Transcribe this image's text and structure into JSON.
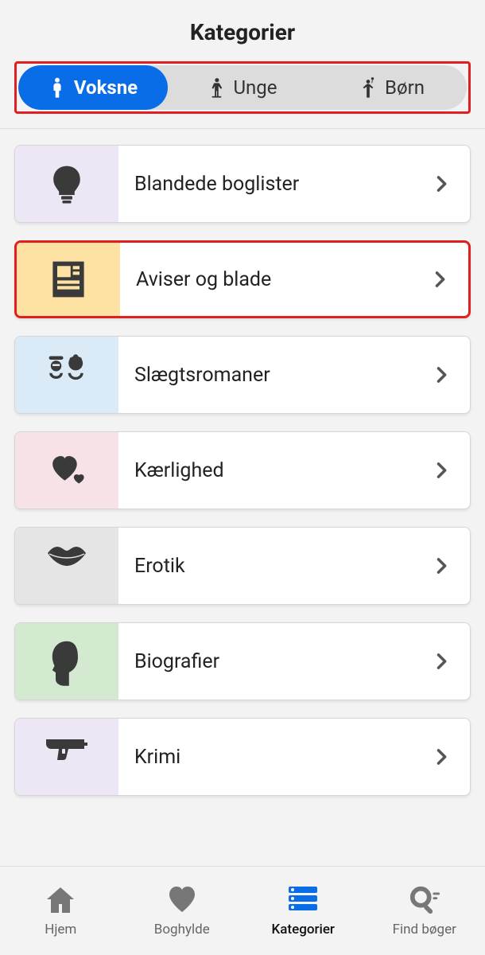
{
  "header": {
    "title": "Kategorier"
  },
  "tabs": [
    {
      "label": "Voksne",
      "active": true,
      "icon": "adult"
    },
    {
      "label": "Unge",
      "active": false,
      "icon": "teen"
    },
    {
      "label": "Børn",
      "active": false,
      "icon": "child"
    }
  ],
  "categories": [
    {
      "label": "Blandede boglister",
      "bg": "#ece6f5",
      "icon": "bulb",
      "highlighted": false
    },
    {
      "label": "Aviser og blade",
      "bg": "#fde2a3",
      "icon": "newspaper",
      "highlighted": true
    },
    {
      "label": "Slægtsromaner",
      "bg": "#dbeaf7",
      "icon": "ancestors",
      "highlighted": false
    },
    {
      "label": "Kærlighed",
      "bg": "#f7e2e7",
      "icon": "hearts",
      "highlighted": false
    },
    {
      "label": "Erotik",
      "bg": "#e5e5e5",
      "icon": "lips",
      "highlighted": false
    },
    {
      "label": "Biografier",
      "bg": "#d3ead1",
      "icon": "profile",
      "highlighted": false
    },
    {
      "label": "Krimi",
      "bg": "#ece6f5",
      "icon": "gun",
      "highlighted": false
    }
  ],
  "nav": [
    {
      "label": "Hjem",
      "icon": "home",
      "active": false
    },
    {
      "label": "Boghylde",
      "icon": "heart",
      "active": false
    },
    {
      "label": "Kategorier",
      "icon": "list",
      "active": true
    },
    {
      "label": "Find bøger",
      "icon": "search",
      "active": false
    }
  ]
}
